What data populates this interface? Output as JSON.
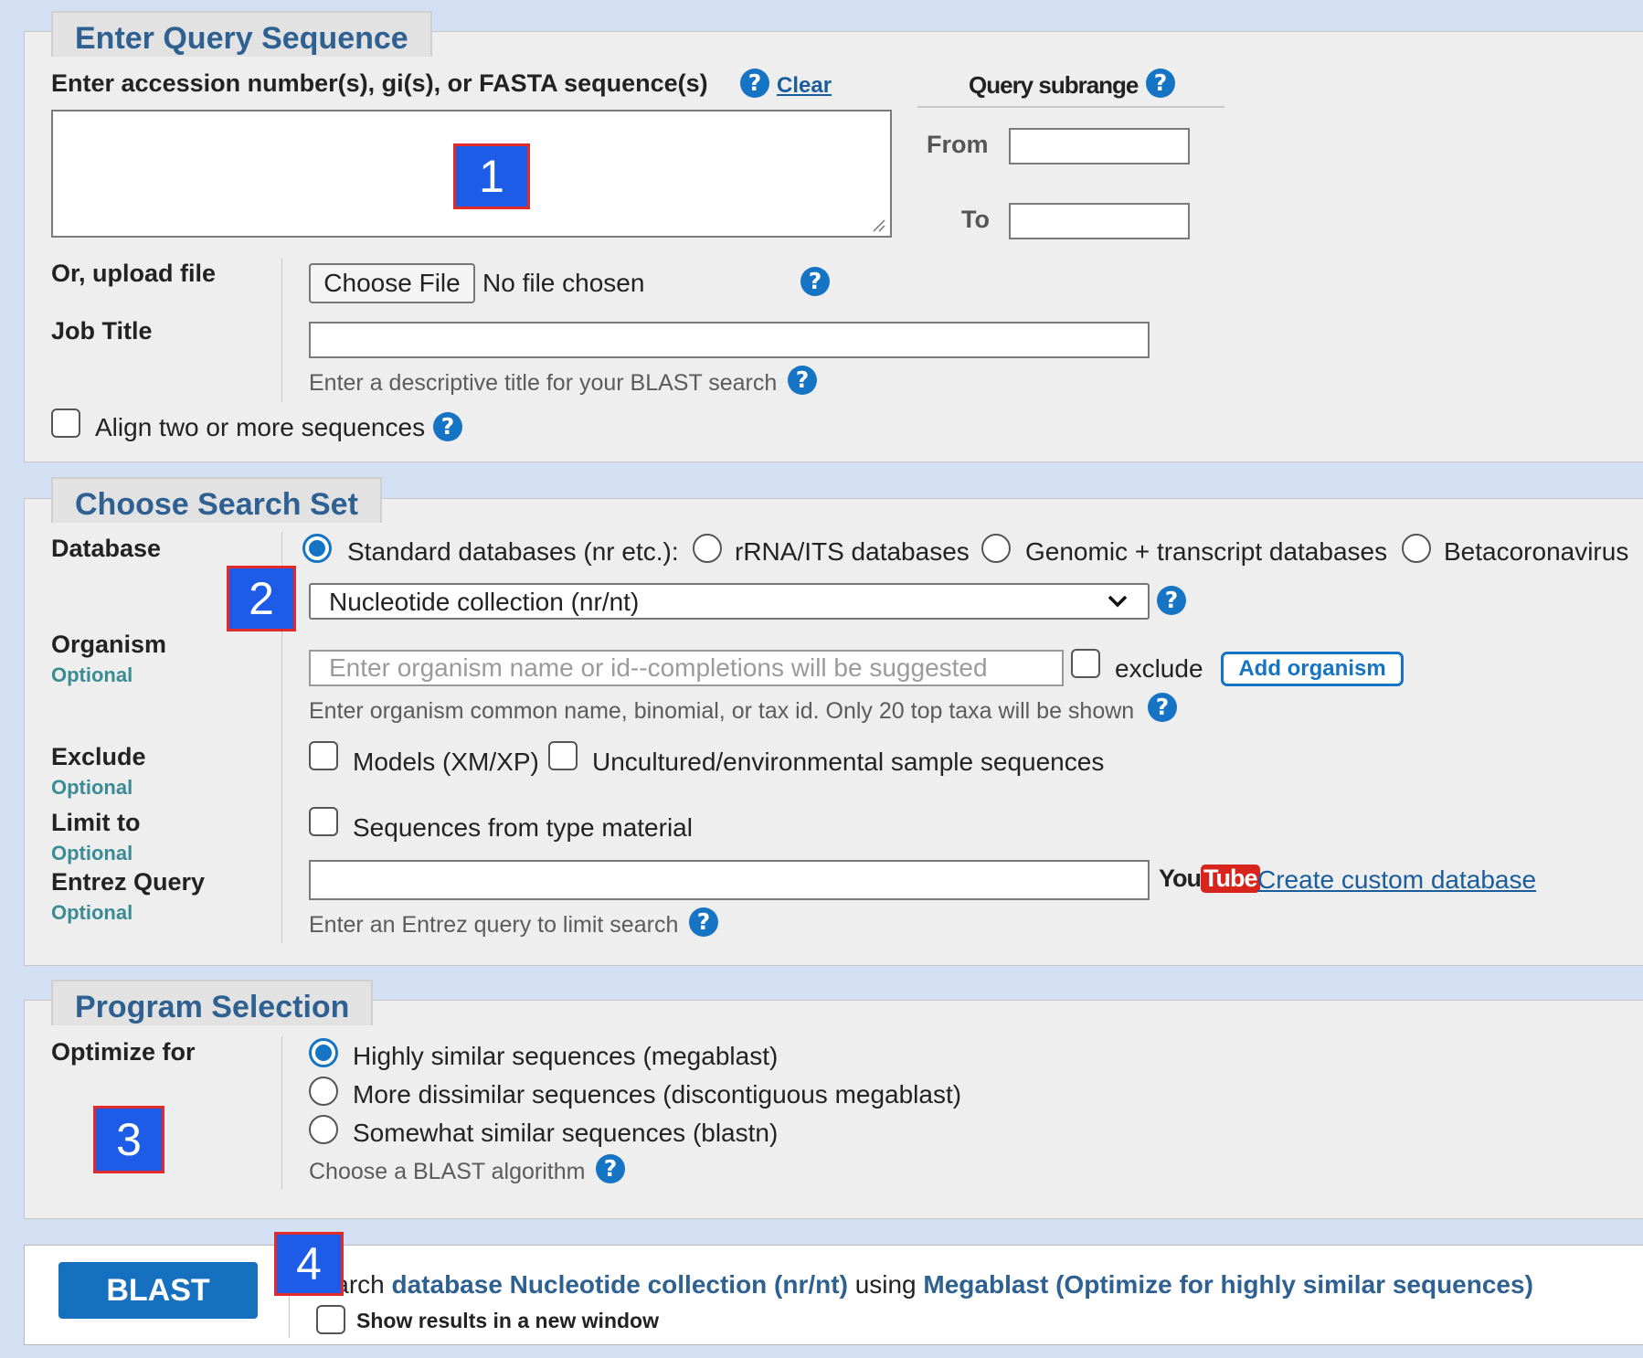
{
  "query_section": {
    "legend": "Enter Query Sequence",
    "accession_label": "Enter accession number(s), gi(s), or FASTA sequence(s)",
    "clear_link": "Clear",
    "subrange_title": "Query subrange",
    "from_label": "From",
    "to_label": "To",
    "upload_label": "Or, upload file",
    "choose_file_button": "Choose File",
    "no_file_text": "No file chosen",
    "job_title_label": "Job Title",
    "job_title_hint": "Enter a descriptive title for your BLAST search",
    "align_label": "Align two or more sequences"
  },
  "search_set": {
    "legend": "Choose Search Set",
    "database_label": "Database",
    "db_options": [
      "Standard databases (nr etc.):",
      "rRNA/ITS databases",
      "Genomic + transcript databases",
      "Betacoronavirus"
    ],
    "db_selected_index": 0,
    "db_select_value": "Nucleotide collection (nr/nt)",
    "organism_label": "Organism",
    "optional": "Optional",
    "organism_placeholder": "Enter organism name or id--completions will be suggested",
    "exclude_checkbox": "exclude",
    "add_organism_button": "Add organism",
    "organism_hint": "Enter organism common name, binomial, or tax id. Only 20 top taxa will be shown",
    "exclude_label": "Exclude",
    "exclude_models": "Models (XM/XP)",
    "exclude_uncultured": "Uncultured/environmental sample sequences",
    "limit_label": "Limit to",
    "limit_type_material": "Sequences from type material",
    "entrez_label": "Entrez Query",
    "youtube_you": "You",
    "youtube_tube": "Tube",
    "custom_db_link": "Create custom database",
    "entrez_hint": "Enter an Entrez query to limit search"
  },
  "program": {
    "legend": "Program Selection",
    "optimize_label": "Optimize for",
    "options": [
      "Highly similar sequences (megablast)",
      "More dissimilar sequences (discontiguous megablast)",
      "Somewhat similar sequences (blastn)"
    ],
    "selected_index": 0,
    "hint": "Choose a BLAST algorithm"
  },
  "submit": {
    "blast_button": "BLAST",
    "search_prefix": "Search",
    "search_database": "database Nucleotide collection (nr/nt)",
    "using_text": "using",
    "search_program": "Megablast (Optimize for highly similar sequences)",
    "new_window_label": "Show results in a new window"
  },
  "badges": [
    "1",
    "2",
    "3",
    "4"
  ],
  "help_glyph": "?",
  "colors": {
    "accent": "#1574c4",
    "legend_text": "#2e6191",
    "optional_text": "#3b8b95",
    "badge_bg": "#1c5ce6",
    "badge_border": "#e12a2a"
  }
}
